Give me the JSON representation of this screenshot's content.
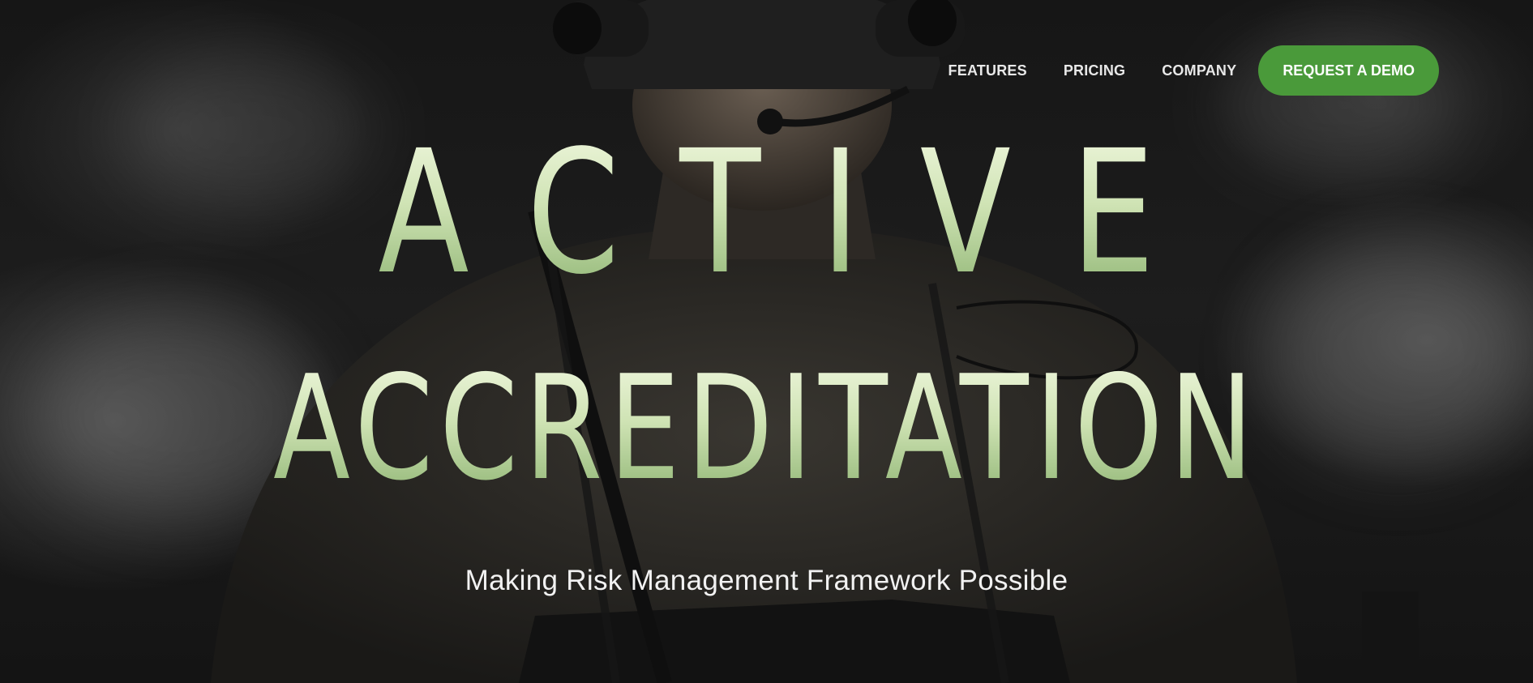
{
  "nav": {
    "links": [
      {
        "label": "FEATURES"
      },
      {
        "label": "PRICING"
      },
      {
        "label": "COMPANY"
      }
    ],
    "cta_label": "REQUEST A DEMO"
  },
  "hero": {
    "title_line1": "ACTIVE",
    "title_line2": "ACCREDITATION",
    "subtitle": "Making Risk Management Framework Possible",
    "background_image": "soldier-with-night-vision-goggles-in-smoke"
  },
  "colors": {
    "accent": "#4a9a3a",
    "title_top": "#eef6dc",
    "title_bottom": "#8fb574",
    "background": "#161616"
  }
}
